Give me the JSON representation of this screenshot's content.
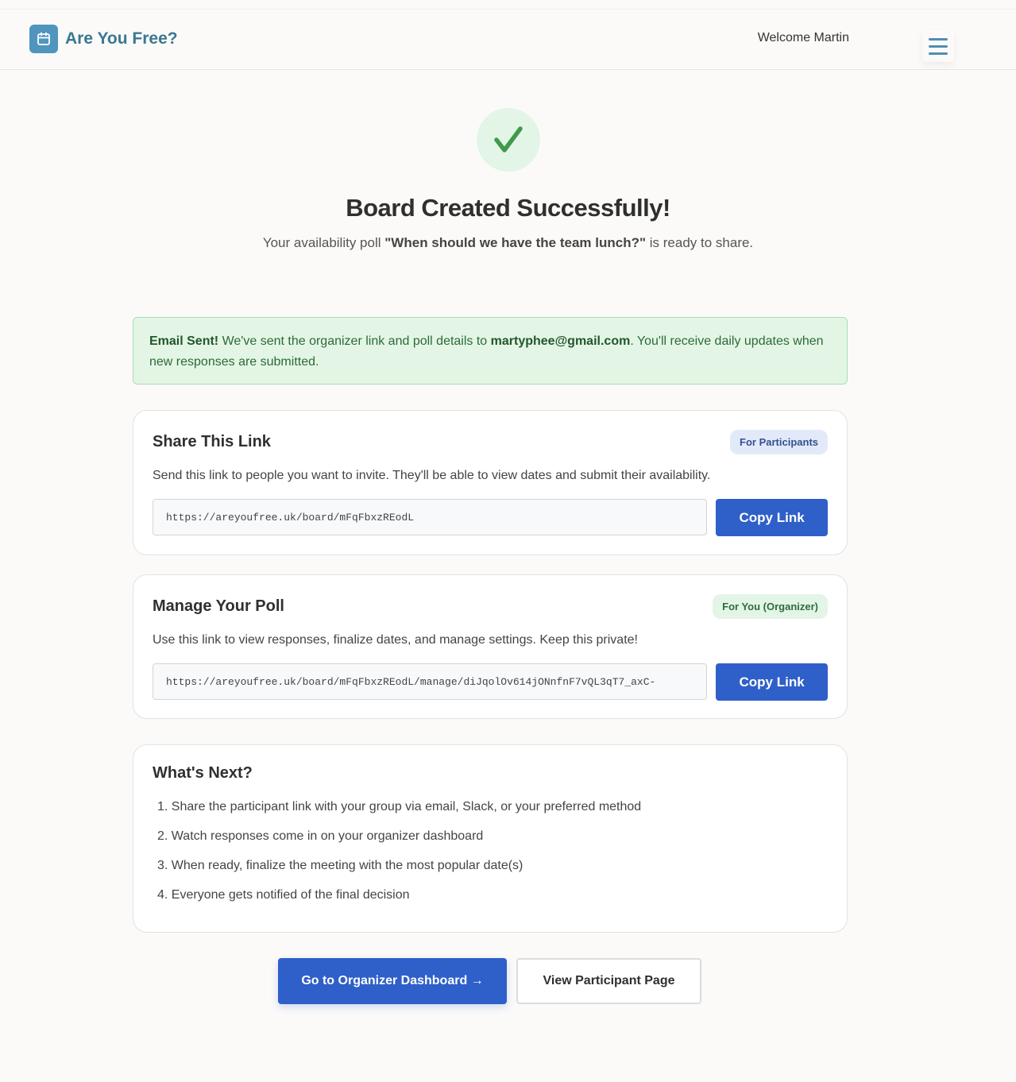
{
  "navbar": {
    "brand_name": "Are You Free?",
    "brand_icon": "calendar-icon",
    "welcome_text": "Welcome Martin",
    "menu_icon": "hamburger-menu-icon"
  },
  "success": {
    "icon": "check-icon",
    "title": "Board Created Successfully!",
    "sub_prefix": "Your availability poll ",
    "poll_name": "\"When should we have the team lunch?\"",
    "sub_suffix": " is ready to share."
  },
  "alert": {
    "strong": "Email Sent!",
    "text_before_email": " We've sent the organizer link and poll details to ",
    "email": "martyphee@gmail.com",
    "text_after_email": ". You'll receive daily updates when new responses are submitted."
  },
  "share_card": {
    "title": "Share This Link",
    "badge": "For Participants",
    "description": "Send this link to people you want to invite. They'll be able to view dates and submit their availability.",
    "link": "https://areyoufree.uk/board/mFqFbxzREodL",
    "copy_label": "Copy Link"
  },
  "manage_card": {
    "title": "Manage Your Poll",
    "badge": "For You (Organizer)",
    "description": "Use this link to view responses, finalize dates, and manage settings. Keep this private!",
    "link": "https://areyoufree.uk/board/mFqFbxzREodL/manage/diJqolOv614jONnfnF7vQL3qT7_axC-",
    "copy_label": "Copy Link"
  },
  "next_card": {
    "title": "What's Next?",
    "steps": [
      "1. Share the participant link with your group via email, Slack, or your preferred method",
      "2. Watch responses come in on your organizer dashboard",
      "3. When ready, finalize the meeting with the most popular date(s)",
      "4. Everyone gets notified of the final decision"
    ]
  },
  "actions": {
    "dashboard_label": "Go to Organizer Dashboard →",
    "participant_label": "View Participant Page"
  },
  "colors": {
    "primary": "#2f5fc8",
    "brand": "#3b7791",
    "success_bg": "#e3f6e6",
    "success_text": "#2d6a36"
  }
}
